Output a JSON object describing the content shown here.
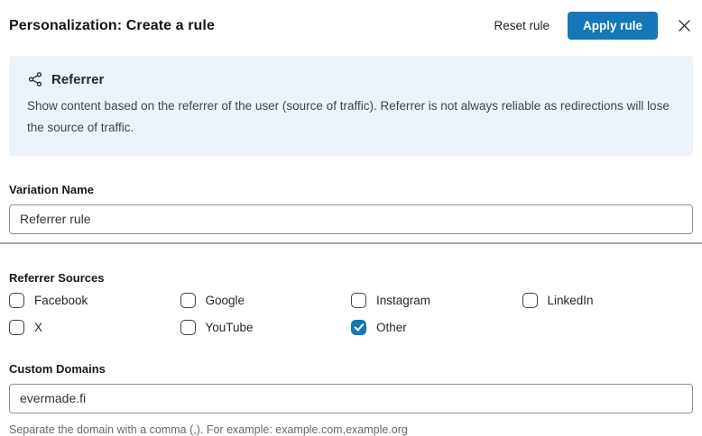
{
  "header": {
    "title": "Personalization: Create a rule",
    "reset_label": "Reset rule",
    "apply_label": "Apply rule",
    "close_icon": "close-x"
  },
  "info_box": {
    "icon": "share-network-icon",
    "title": "Referrer",
    "description": "Show content based on the referrer of the user (source of traffic). Referrer is not always reliable as redirections will lose the source of traffic."
  },
  "variation_name": {
    "label": "Variation Name",
    "value": "Referrer rule"
  },
  "referrer_sources": {
    "label": "Referrer Sources",
    "options": [
      {
        "label": "Facebook",
        "checked": false
      },
      {
        "label": "Google",
        "checked": false
      },
      {
        "label": "Instagram",
        "checked": false
      },
      {
        "label": "LinkedIn",
        "checked": false
      },
      {
        "label": "X",
        "checked": false
      },
      {
        "label": "YouTube",
        "checked": false
      },
      {
        "label": "Other",
        "checked": true
      }
    ]
  },
  "custom_domains": {
    "label": "Custom Domains",
    "value": "evermade.fi",
    "help": "Separate the domain with a comma (,). For example: example.com,example.org"
  },
  "colors": {
    "accent": "#1577b7",
    "info_box_bg": "#edf3fa"
  }
}
